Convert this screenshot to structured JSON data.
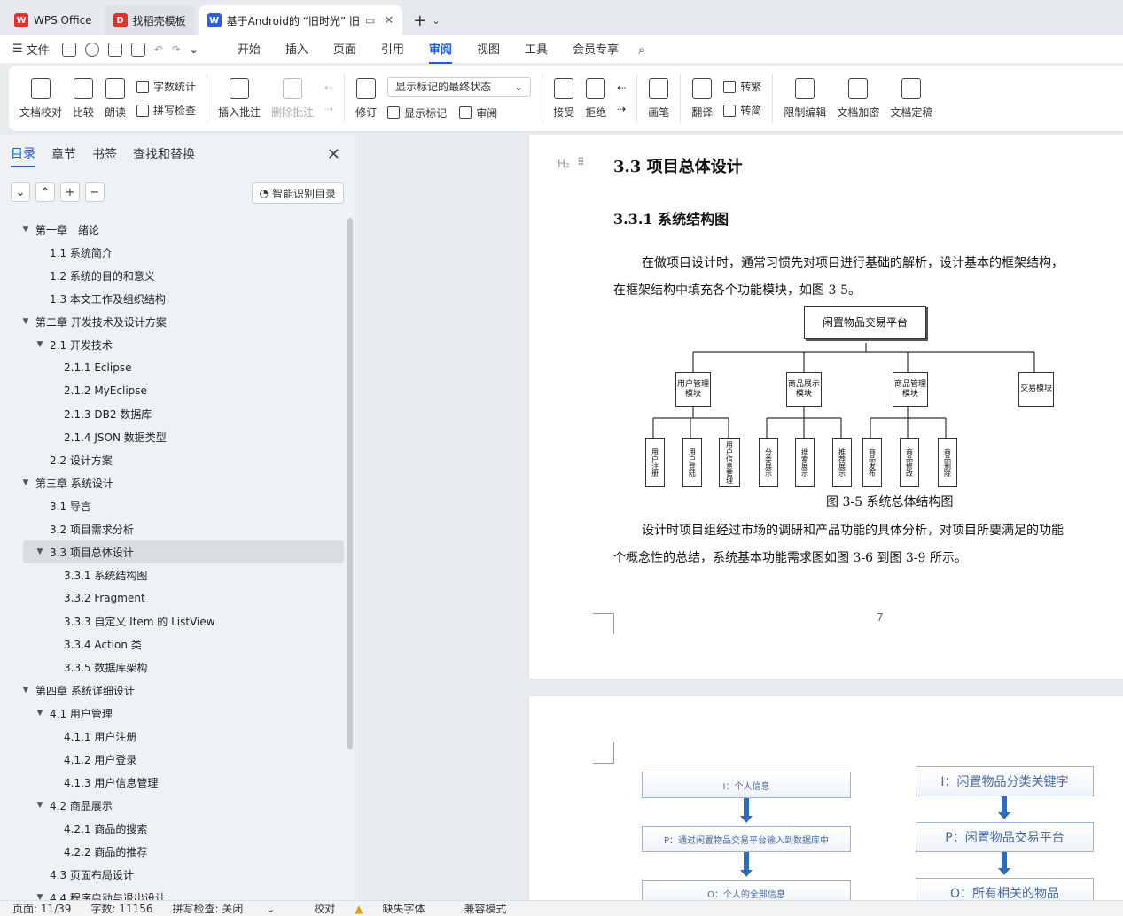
{
  "tabs": [
    {
      "label": "WPS Office",
      "icon": "wps-logo-icon",
      "color": "#e0332b"
    },
    {
      "label": "找稻壳模板",
      "icon": "docer-icon",
      "color": "#e0332b"
    },
    {
      "label": "基于Android的 “旧时光” 旧",
      "icon": "word-doc-icon",
      "color": "#2b62d9"
    }
  ],
  "menubar": {
    "file": "文件",
    "tabs": [
      "开始",
      "插入",
      "页面",
      "引用",
      "审阅",
      "视图",
      "工具",
      "会员专享"
    ],
    "active_tab": "审阅"
  },
  "ribbon": {
    "doc_check": "文档校对",
    "compare": "比较",
    "read_aloud": "朗读",
    "word_count": "字数统计",
    "spell_check": "拼写检查",
    "insert_comment": "插入批注",
    "delete_comment": "删除批注",
    "track": "修订",
    "markup_select": "显示标记的最终状态",
    "show_markup": "显示标记",
    "review": "审阅",
    "accept": "接受",
    "reject": "拒绝",
    "pen": "画笔",
    "translate": "翻译",
    "to_traditional": "转繁",
    "to_simplified": "转简",
    "restrict_edit": "限制编辑",
    "encrypt": "文档加密",
    "finalize": "文档定稿"
  },
  "nav": {
    "tabs": [
      "目录",
      "章节",
      "书签",
      "查找和替换"
    ],
    "smart_button": "智能识别目录",
    "toc": [
      {
        "text": "第一章　绪论",
        "level": 0,
        "expanded": true
      },
      {
        "text": "1.1 系统简介",
        "level": 1
      },
      {
        "text": "1.2 系统的目的和意义",
        "level": 1
      },
      {
        "text": "1.3 本文工作及组织结构",
        "level": 1
      },
      {
        "text": "第二章  开发技术及设计方案",
        "level": 0,
        "expanded": true
      },
      {
        "text": "2.1  开发技术",
        "level": 1,
        "expanded": true
      },
      {
        "text": "2.1.1 Eclipse",
        "level": 2
      },
      {
        "text": "2.1.2 MyEclipse",
        "level": 2
      },
      {
        "text": "2.1.3 DB2 数据库",
        "level": 2
      },
      {
        "text": "2.1.4 JSON 数据类型",
        "level": 2
      },
      {
        "text": "2.2 设计方案",
        "level": 1
      },
      {
        "text": "第三章  系统设计",
        "level": 0,
        "expanded": true
      },
      {
        "text": "3.1 导言",
        "level": 1
      },
      {
        "text": "3.2 项目需求分析",
        "level": 1
      },
      {
        "text": "3.3 项目总体设计",
        "level": 1,
        "expanded": true,
        "selected": true
      },
      {
        "text": "3.3.1 系统结构图",
        "level": 2
      },
      {
        "text": "3.3.2 Fragment",
        "level": 2
      },
      {
        "text": "3.3.3 自定义 Item 的 ListView",
        "level": 2
      },
      {
        "text": "3.3.4 Action 类",
        "level": 2
      },
      {
        "text": "3.3.5  数据库架构",
        "level": 2
      },
      {
        "text": "第四章  系统详细设计",
        "level": 0,
        "expanded": true
      },
      {
        "text": "4.1  用户管理",
        "level": 1,
        "expanded": true
      },
      {
        "text": "4.1.1 用户注册",
        "level": 2
      },
      {
        "text": "4.1.2 用户登录",
        "level": 2
      },
      {
        "text": "4.1.3  用户信息管理",
        "level": 2
      },
      {
        "text": "4.2  商品展示",
        "level": 1,
        "expanded": true
      },
      {
        "text": "4.2.1 商品的搜索",
        "level": 2
      },
      {
        "text": "4.2.2 商品的推荐",
        "level": 2
      },
      {
        "text": "4.3  页面布局设计",
        "level": 1
      },
      {
        "text": "4.4  程序启动与退出设计",
        "level": 1,
        "expanded": true
      }
    ]
  },
  "document": {
    "heading2": "3.3 项目总体设计",
    "heading2_marker": "H₂",
    "heading3": "3.3.1 系统结构图",
    "para1_line1": "在做项目设计时，通常习惯先对项目进行基础的解析，设计基本的框架结构，",
    "para1_line2": "在框架结构中填充各个功能模块，如图 3-5。",
    "figure_caption": "图 3-5 系统总体结构图",
    "para2_line1": "设计时项目组经过市场的调研和产品功能的具体分析，对项目所要满足的功能",
    "para2_line2": "个概念性的总结，系统基本功能需求图如图 3-6 到图 3-9 所示。",
    "page_number": "7",
    "diagram": {
      "root": "闲置物品交易平台",
      "modules": [
        "用户管理模块",
        "商品展示模块",
        "商品管理模块",
        "交易模块"
      ],
      "leaves_user": [
        "用户注册",
        "用户登陆",
        "用户信息管理"
      ],
      "leaves_show": [
        "分类展示",
        "搜索展示",
        "推荐展示"
      ],
      "leaves_manage": [
        "商品发布",
        "商品修改",
        "商品删除"
      ]
    },
    "flow_left": [
      "I：个人信息",
      "P：通过闲置物品交易平台输入到数据库中",
      "O：个人的全部信息"
    ],
    "flow_right": [
      "I：闲置物品分类关键字",
      "P：闲置物品交易平台",
      "O：所有相关的物品"
    ]
  },
  "status": {
    "page": "页面: 11/39",
    "words": "字数: 11156",
    "spell": "拼写检查: 关闭",
    "proof": "校对",
    "missing_font": "缺失字体",
    "compat": "兼容模式"
  }
}
